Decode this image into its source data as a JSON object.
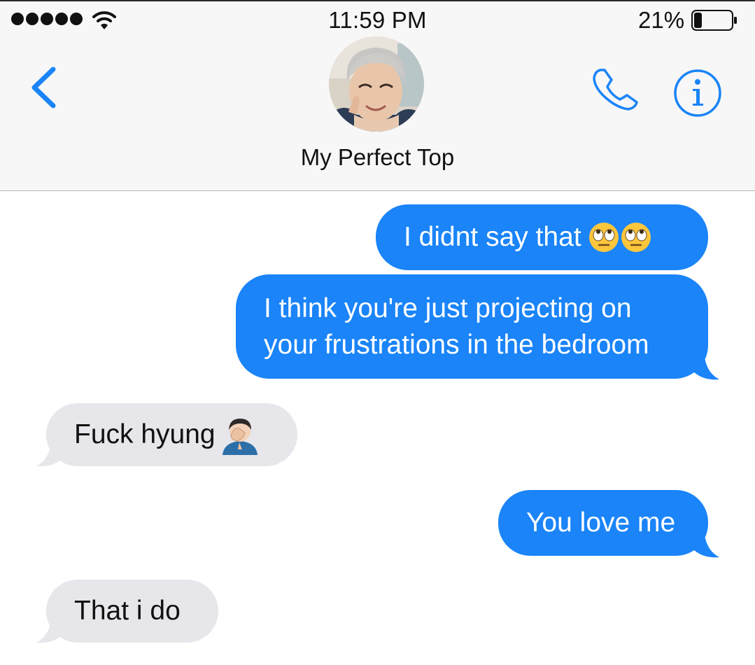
{
  "status_bar": {
    "time": "11:59 PM",
    "battery_percent": "21%",
    "battery_level": 0.21,
    "signal_icon": "signal-dots-icon",
    "wifi_icon": "wifi-icon"
  },
  "header": {
    "contact_name": "My Perfect Top",
    "back_icon": "chevron-left-icon",
    "call_icon": "phone-icon",
    "info_icon": "info-icon"
  },
  "colors": {
    "sent_bubble": "#1a84f8",
    "received_bubble": "#e6e6eb",
    "accent": "#1a84f8"
  },
  "messages": [
    {
      "direction": "sent",
      "lines": [
        "I didnt say that"
      ],
      "emoji": "eye-roll-emoji x2"
    },
    {
      "direction": "sent",
      "lines": [
        "I think you're just projecting on",
        "your frustrations in the bedroom"
      ]
    },
    {
      "direction": "received",
      "lines": [
        "Fuck hyung"
      ],
      "emoji": "facepalm-emoji"
    },
    {
      "direction": "sent",
      "lines": [
        "You love me"
      ]
    },
    {
      "direction": "received",
      "lines": [
        "That i do"
      ]
    }
  ]
}
